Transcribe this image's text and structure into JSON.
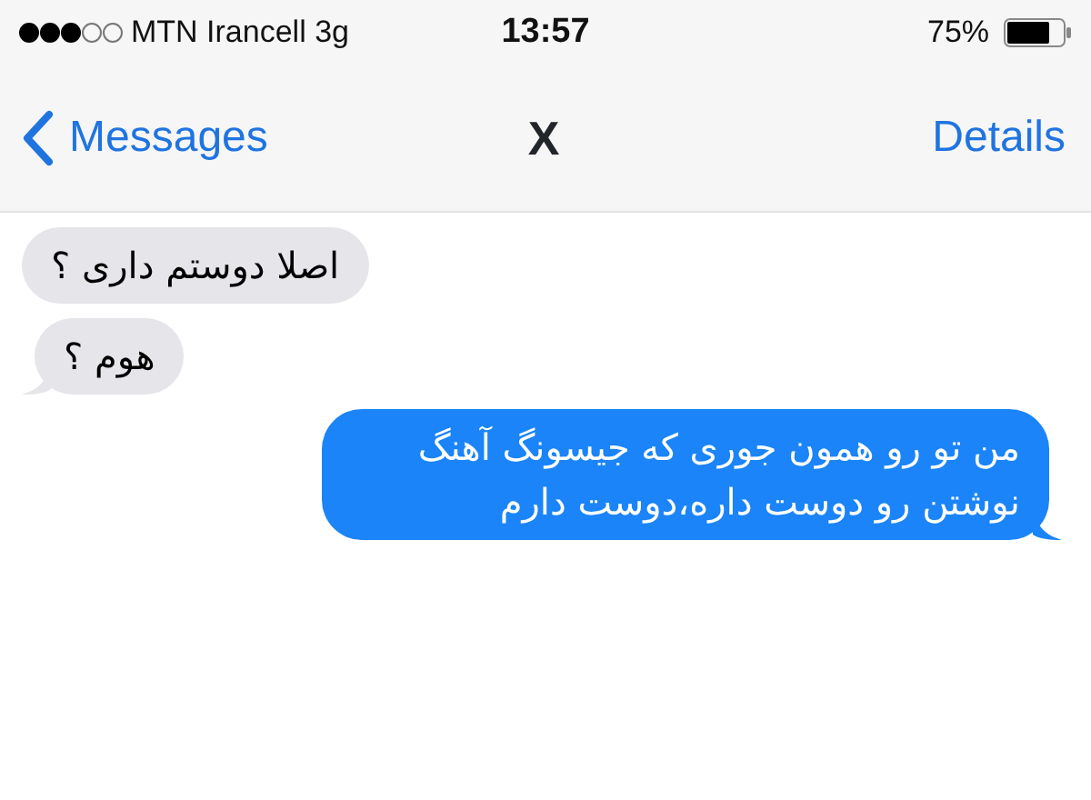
{
  "status_bar": {
    "carrier": "MTN Irancell 3g",
    "time": "13:57",
    "battery": "75%"
  },
  "nav": {
    "back": "Messages",
    "title": "X",
    "action": "Details"
  },
  "messages": [
    {
      "kind": "incoming",
      "text": "اصلا دوستم داری ؟",
      "tail": false
    },
    {
      "kind": "incoming",
      "text": "هوم ؟",
      "tail": true
    },
    {
      "kind": "outgoing",
      "text": "من تو رو همون جوری که جیسونگ آهنگ نوشتن رو دوست داره،دوست دارم",
      "tail": true
    }
  ]
}
